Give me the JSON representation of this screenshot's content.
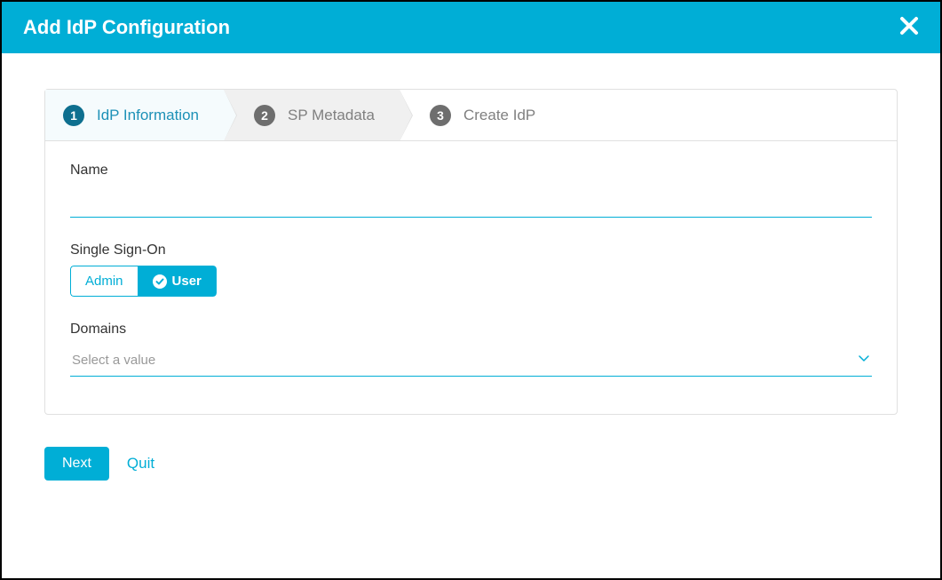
{
  "header": {
    "title": "Add IdP Configuration"
  },
  "stepper": {
    "steps": [
      {
        "num": "1",
        "label": "IdP Information"
      },
      {
        "num": "2",
        "label": "SP Metadata"
      },
      {
        "num": "3",
        "label": "Create IdP"
      }
    ]
  },
  "form": {
    "name_label": "Name",
    "name_value": "",
    "sso_label": "Single Sign-On",
    "sso_options": {
      "admin": "Admin",
      "user": "User"
    },
    "domains_label": "Domains",
    "domains_placeholder": "Select a value"
  },
  "footer": {
    "next": "Next",
    "quit": "Quit"
  }
}
